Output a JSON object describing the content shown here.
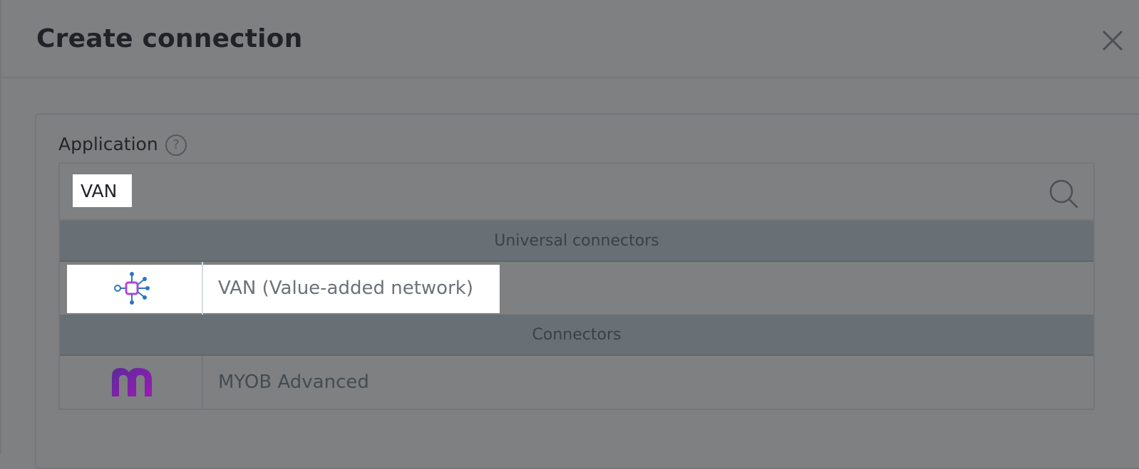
{
  "dialog": {
    "title": "Create connection"
  },
  "application_field": {
    "label": "Application",
    "help_glyph": "?",
    "search_value": "VAN"
  },
  "results": {
    "groups": [
      {
        "header": "Universal connectors",
        "items": [
          {
            "name": "VAN (Value-added network)",
            "icon": "van-network-logo",
            "highlighted": true
          }
        ]
      },
      {
        "header": "Connectors",
        "items": [
          {
            "name": "MYOB Advanced",
            "icon": "myob-logo",
            "highlighted": false
          }
        ]
      }
    ]
  },
  "colors": {
    "overlay": "#7f8081",
    "group_header_bg": "#697075",
    "myob_purple_start": "#5b2a9a",
    "myob_purple_end": "#9b1bb5",
    "van_blue": "#2f74c0",
    "van_purple": "#b344d8"
  }
}
